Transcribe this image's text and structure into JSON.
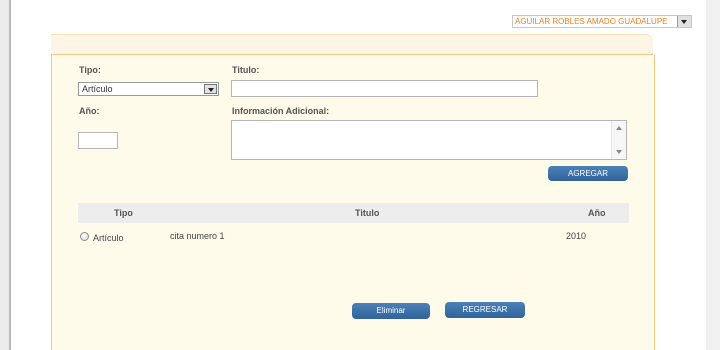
{
  "header": {
    "user_select_value": "AGUILAR ROBLES AMADO GUADALUPE"
  },
  "form": {
    "tipo_label": "Tipo:",
    "tipo_value": "Artículo",
    "titulo_label": "Titulo:",
    "titulo_value": "",
    "anio_label": "Año:",
    "anio_value": "",
    "info_label": "Información Adicional:",
    "info_value": "",
    "agregar_label": "AGREGAR"
  },
  "table": {
    "headers": {
      "tipo": "Tipo",
      "titulo": "Titulo",
      "anio": "Año"
    },
    "rows": [
      {
        "tipo": "Artículo",
        "titulo": "cita numero 1",
        "anio": "2010"
      }
    ]
  },
  "actions": {
    "eliminar_label": "Eliminar",
    "regresar_label": "REGRESAR"
  },
  "colors": {
    "accent_orange": "#f07f1c",
    "button_blue": "#2f6399",
    "panel_bg": "#fffbea"
  }
}
